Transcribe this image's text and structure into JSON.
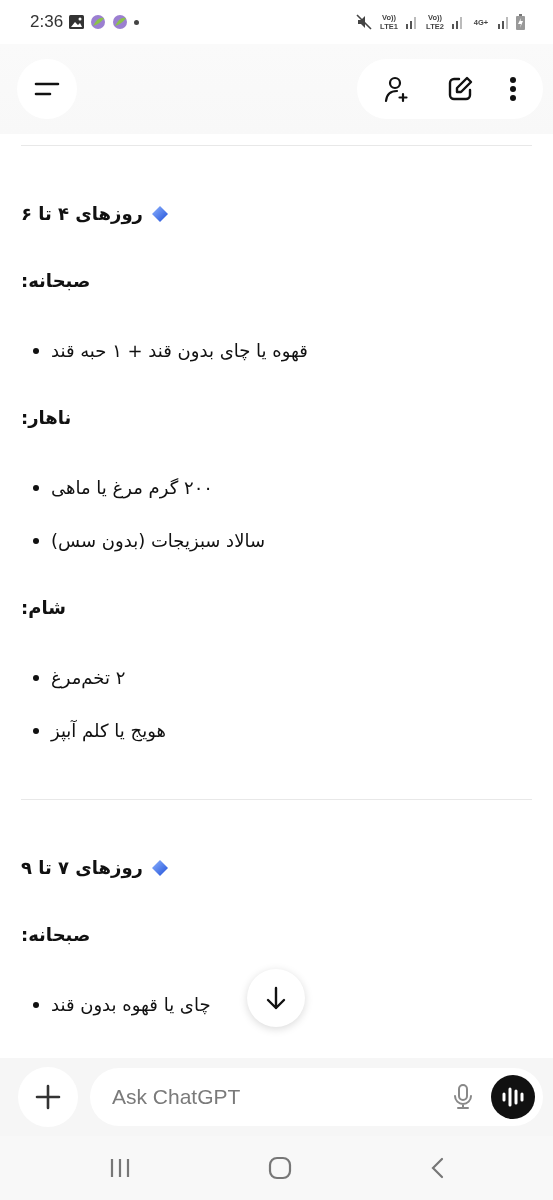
{
  "status_bar": {
    "time": "2:36",
    "sim_1": {
      "top": "Vo))",
      "bottom": "LTE1"
    },
    "sim_2": {
      "top": "Vo))",
      "bottom": "LTE2"
    },
    "network_type": "4G+"
  },
  "sections": [
    {
      "title": "روزهای ۴ تا ۶",
      "meals": [
        {
          "label": "صبحانه:",
          "items": [
            "قهوه یا چای بدون قند + ۱ حبه قند"
          ]
        },
        {
          "label": "ناهار:",
          "items": [
            "۲۰۰ گرم مرغ یا ماهی",
            "سالاد سبزیجات (بدون سس)"
          ]
        },
        {
          "label": "شام:",
          "items": [
            "۲ تخم‌مرغ",
            "هویج یا کلم آبپز"
          ]
        }
      ]
    },
    {
      "title": "روزهای ۷ تا ۹",
      "meals": [
        {
          "label": "صبحانه:",
          "items": [
            "چای یا قهوه بدون قند"
          ]
        }
      ]
    }
  ],
  "composer": {
    "placeholder": "Ask ChatGPT"
  }
}
